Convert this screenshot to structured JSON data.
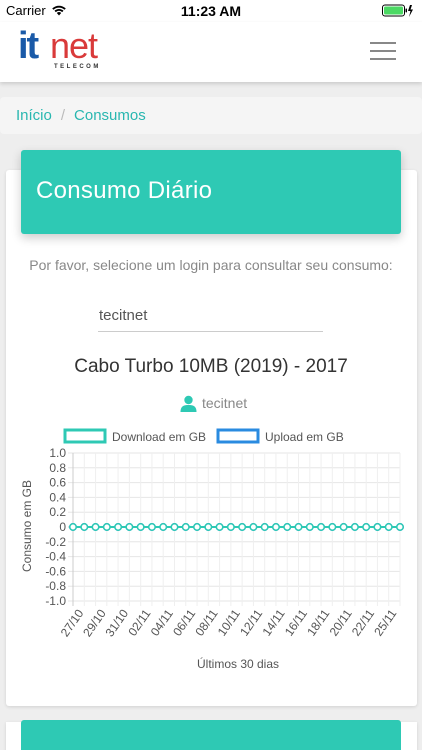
{
  "status_bar": {
    "carrier": "Carrier",
    "time": "11:23 AM"
  },
  "header": {
    "logo_it": "it",
    "logo_net": "net",
    "logo_tagline": "TELECOM"
  },
  "breadcrumb": {
    "items": [
      "Início",
      "Consumos"
    ],
    "separator": "/"
  },
  "card": {
    "title": "Consumo Diário",
    "instruction": "Por favor, selecione um login para consultar seu consumo:",
    "login_value": "tecitnet",
    "plan_title": "Cabo Turbo 10MB (2019) - 2017",
    "user_name": "tecitnet"
  },
  "colors": {
    "accent": "#2ec9b4",
    "link": "#29b7b0",
    "download_series": "#2ec9b4",
    "upload_series": "#2a8be0",
    "logo_blue": "#1a5aa8",
    "logo_red": "#d93a3a"
  },
  "chart_data": {
    "type": "line",
    "ylabel": "Consumo em GB",
    "xlabel": "Últimos 30 dias",
    "ylim": [
      -1.0,
      1.0
    ],
    "yticks": [
      "1.0",
      "0.8",
      "0.6",
      "0.4",
      "0.2",
      "0",
      "-0.2",
      "-0.4",
      "-0.6",
      "-0.8",
      "-1.0"
    ],
    "xticks": [
      "27/10",
      "29/10",
      "31/10",
      "02/11",
      "04/11",
      "06/11",
      "08/11",
      "10/11",
      "12/11",
      "14/11",
      "16/11",
      "18/11",
      "20/11",
      "22/11",
      "25/11"
    ],
    "legend": "top",
    "series": [
      {
        "name": "Download em GB",
        "color": "#2ec9b4",
        "values": [
          0,
          0,
          0,
          0,
          0,
          0,
          0,
          0,
          0,
          0,
          0,
          0,
          0,
          0,
          0,
          0,
          0,
          0,
          0,
          0,
          0,
          0,
          0,
          0,
          0,
          0,
          0,
          0,
          0,
          0
        ]
      },
      {
        "name": "Upload em GB",
        "color": "#2a8be0",
        "values": [
          0,
          0,
          0,
          0,
          0,
          0,
          0,
          0,
          0,
          0,
          0,
          0,
          0,
          0,
          0,
          0,
          0,
          0,
          0,
          0,
          0,
          0,
          0,
          0,
          0,
          0,
          0,
          0,
          0,
          0
        ]
      }
    ]
  }
}
